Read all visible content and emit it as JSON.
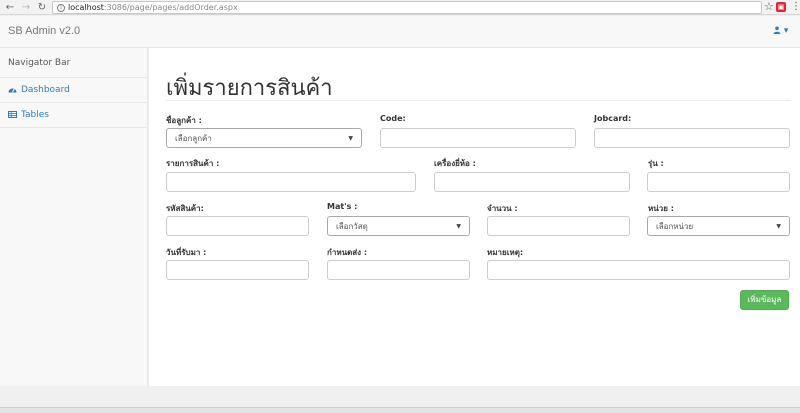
{
  "browser": {
    "url_host": "localhost",
    "url_path": ":3086/page/pages/addOrder.aspx",
    "back_icon": "arrow-left-icon",
    "forward_icon": "arrow-right-icon",
    "reload_icon": "reload-icon"
  },
  "navbar": {
    "brand": "SB Admin v2.0",
    "user_caret": "▾"
  },
  "sidebar": {
    "header": "Navigator Bar",
    "items": [
      {
        "label": "Dashboard",
        "icon": "dashboard-icon"
      },
      {
        "label": "Tables",
        "icon": "table-icon"
      }
    ]
  },
  "form": {
    "title": "เพิ่มรายการสินค้า",
    "customer": {
      "label": "ชื่อลูกค้า :",
      "value": "เลือกลูกค้า"
    },
    "code": {
      "label": "Code:",
      "value": ""
    },
    "jobcard": {
      "label": "Jobcard:",
      "value": ""
    },
    "product_list": {
      "label": "รายการสินค้า :",
      "value": ""
    },
    "brand": {
      "label": "เครื่องยี่ห้อ :",
      "value": ""
    },
    "model": {
      "label": "รุ่น :",
      "value": ""
    },
    "product_code": {
      "label": "รหัสสินค้า:",
      "value": ""
    },
    "mats": {
      "label": "Mat's :",
      "value": "เลือกวัสดุ"
    },
    "quantity": {
      "label": "จำนวน :",
      "value": ""
    },
    "unit": {
      "label": "หน่วย :",
      "value": "เลือกหน่วย"
    },
    "receive_date": {
      "label": "วันที่รับมา :",
      "value": ""
    },
    "due_date": {
      "label": "กำหนดส่ง :",
      "value": ""
    },
    "note": {
      "label": "หมายเหตุ:",
      "value": ""
    },
    "submit_label": "เพิ่มข้อมูล"
  },
  "colors": {
    "link": "#337ab7",
    "success": "#5cb85c"
  }
}
